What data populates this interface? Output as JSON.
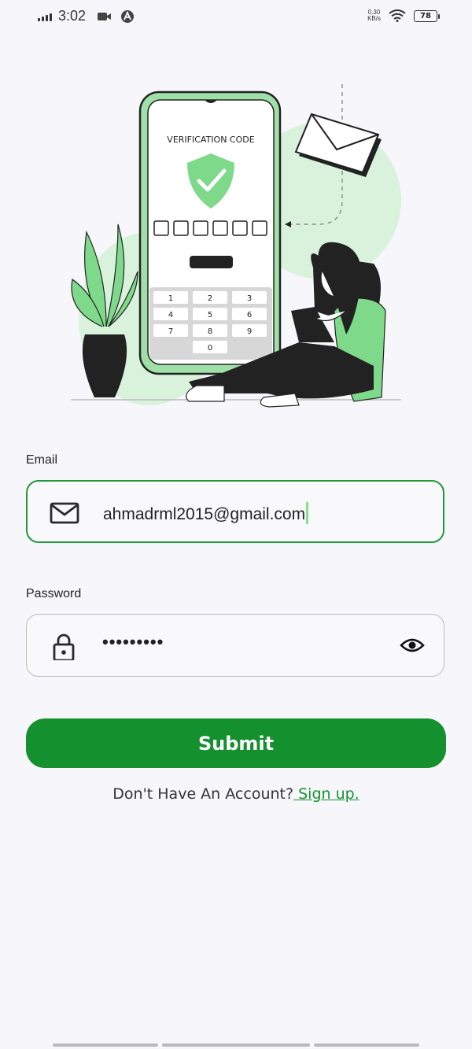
{
  "status_bar": {
    "time": "3:02",
    "net_speed_value": "0.30",
    "net_speed_unit": "KB/s",
    "battery": "78"
  },
  "illustration": {
    "phone_heading": "VERIFICATION CODE",
    "keypad": [
      "1",
      "2",
      "3",
      "4",
      "5",
      "6",
      "7",
      "8",
      "9",
      "0"
    ],
    "colors": {
      "accent": "#7ed98b",
      "blob": "#d9f2dc"
    }
  },
  "form": {
    "email_label": "Email",
    "email_value": "ahmadrml2015@gmail.com",
    "password_label": "Password",
    "password_value": "•••••••••",
    "submit_label": "Submit",
    "signup_prompt": "Don't Have An Account?",
    "signup_link": " Sign up."
  },
  "colors": {
    "primary": "#15902f",
    "focus_border": "#1f9a3a",
    "background": "#f7f6fb"
  }
}
